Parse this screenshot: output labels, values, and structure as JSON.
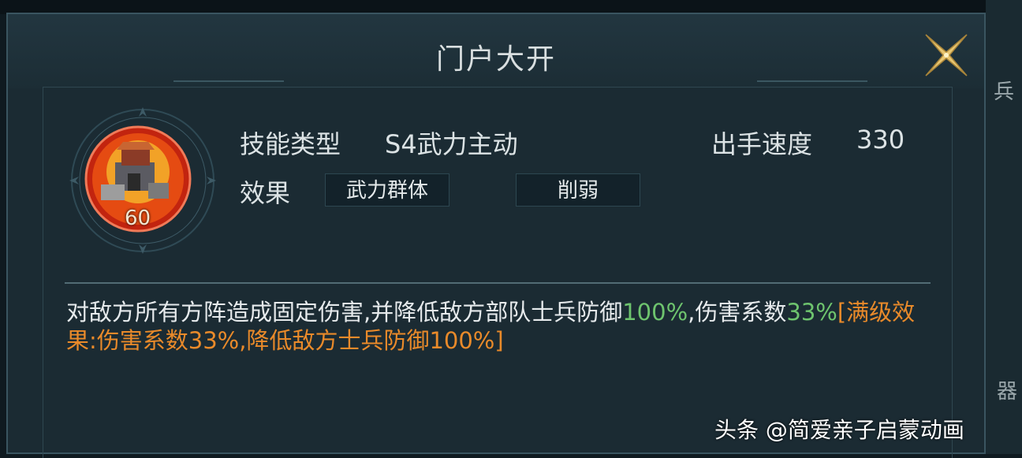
{
  "dialog": {
    "title": "门户大开",
    "close_icon": "close-x-icon"
  },
  "skill": {
    "badge_level": "60",
    "type_label": "技能类型",
    "type_value": "S4武力主动",
    "speed_label": "出手速度",
    "speed_value": "330",
    "effect_label": "效果",
    "tags": [
      "武力群体",
      "削弱"
    ]
  },
  "description": {
    "part1": "对敌方所有方阵造成固定伤害,并降低敌方部队士兵防御",
    "val1": "100%",
    "part2": ",伤害系数",
    "val2": "33%",
    "maxlevel": "[满级效果:伤害系数33%,降低敌方士兵防御100%]"
  },
  "background_fragments": [
    "兵",
    "器"
  ],
  "watermark": "头条 @简爱亲子启蒙动画",
  "colors": {
    "highlight_green": "#6ec46e",
    "highlight_orange": "#e98a2a",
    "close_gold": "#e9c670"
  }
}
